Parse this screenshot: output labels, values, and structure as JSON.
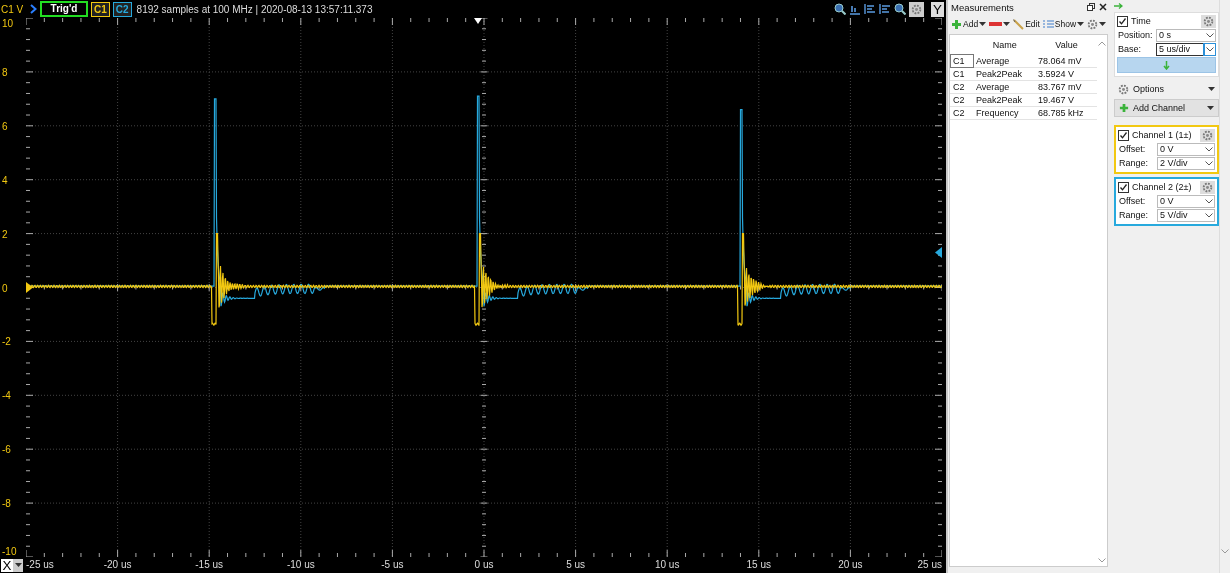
{
  "scope": {
    "axis_unit": "C1 V",
    "trigger_status": "Trig'd",
    "channels": [
      {
        "label": "C1",
        "color": "#f2c811"
      },
      {
        "label": "C2",
        "color": "#27a9dd"
      }
    ],
    "acquisition_info": "8192 samples at 100 MHz | 2020-08-13 13:57:11.373",
    "y_axis_button": "Y",
    "x_axis_selector": "X",
    "y_ticks": [
      "10",
      "8",
      "6",
      "4",
      "2",
      "0",
      "-2",
      "-4",
      "-6",
      "-8",
      "-10"
    ],
    "x_ticks": [
      "-25 us",
      "-20 us",
      "-15 us",
      "-10 us",
      "-5 us",
      "0 us",
      "5 us",
      "10 us",
      "15 us",
      "20 us",
      "25 us"
    ]
  },
  "measurements": {
    "title": "Measurements",
    "toolbar": [
      {
        "kind": "add",
        "label": "Add",
        "menu": true
      },
      {
        "kind": "remove",
        "menu": true
      },
      {
        "kind": "edit",
        "label": "Edit",
        "menu": false
      },
      {
        "kind": "show",
        "label": "Show",
        "menu": true
      },
      {
        "kind": "settings",
        "menu": true
      }
    ],
    "columns": [
      "Name",
      "Value"
    ],
    "rows": [
      {
        "channel": "C1",
        "name": "Average",
        "value": "78.064 mV",
        "selected": true
      },
      {
        "channel": "C1",
        "name": "Peak2Peak",
        "value": "3.5924 V",
        "selected": false
      },
      {
        "channel": "C2",
        "name": "Average",
        "value": "83.767 mV",
        "selected": false
      },
      {
        "channel": "C2",
        "name": "Peak2Peak",
        "value": "19.467 V",
        "selected": false
      },
      {
        "channel": "C2",
        "name": "Frequency",
        "value": "68.785 kHz",
        "selected": false
      }
    ]
  },
  "time": {
    "title": "Time",
    "checked": true,
    "fields": [
      {
        "label": "Position:",
        "value": "0 s",
        "focused": false
      },
      {
        "label": "Base:",
        "value": "5 us/div",
        "focused": true
      }
    ]
  },
  "options": "Options",
  "add_channel": "Add Channel",
  "channels": [
    {
      "title": "Channel 1 (1±)",
      "checked": true,
      "color": "#f2c811",
      "fields": [
        {
          "label": "Offset:",
          "value": "0 V"
        },
        {
          "label": "Range:",
          "value": "2 V/div"
        }
      ]
    },
    {
      "title": "Channel 2 (2±)",
      "checked": true,
      "color": "#27a9dd",
      "fields": [
        {
          "label": "Offset:",
          "value": "0 V"
        },
        {
          "label": "Range:",
          "value": "5 V/div"
        }
      ]
    }
  ]
}
